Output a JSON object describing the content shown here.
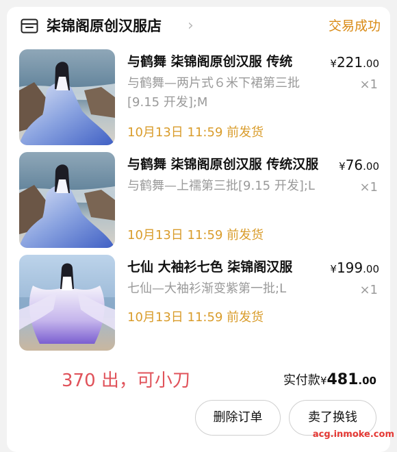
{
  "header": {
    "store_name": "柒锦阁原创汉服店",
    "chevron": "›",
    "status": "交易成功",
    "store_icon": "store-icon"
  },
  "items": [
    {
      "title": "与鹤舞 柒锦阁原创汉服 传统",
      "price_currency": "¥",
      "price_int": "221",
      "price_dec": ".00",
      "spec": "与鹤舞—两片式６米下裙第三批[9.15 开发];M",
      "qty": "×1",
      "ship": "10月13日 11:59 前发货"
    },
    {
      "title": "与鹤舞 柒锦阁原创汉服 传统汉服",
      "price_currency": "¥",
      "price_int": "76",
      "price_dec": ".00",
      "spec": "与鹤舞—上襦第三批[9.15 开发];L",
      "qty": "×1",
      "ship": "10月13日 11:59 前发货"
    },
    {
      "title": "七仙 大袖衫七色 柒锦阁汉服",
      "price_currency": "¥",
      "price_int": "199",
      "price_dec": ".00",
      "spec": "七仙—大袖衫渐变紫第一批;L",
      "qty": "×1",
      "ship": "10月13日 11:59 前发货"
    }
  ],
  "note": "370 出，可小刀",
  "total": {
    "label": "实付款",
    "currency": "¥",
    "int": "481",
    "dec": ".00"
  },
  "buttons": {
    "delete_order": "删除订单",
    "sell": "卖了换钱"
  },
  "watermark": "acg.inmoke.com",
  "colors": {
    "status": "#d98a14",
    "ship": "#d99c2b",
    "note": "#e0525a",
    "watermark": "#e53935"
  }
}
